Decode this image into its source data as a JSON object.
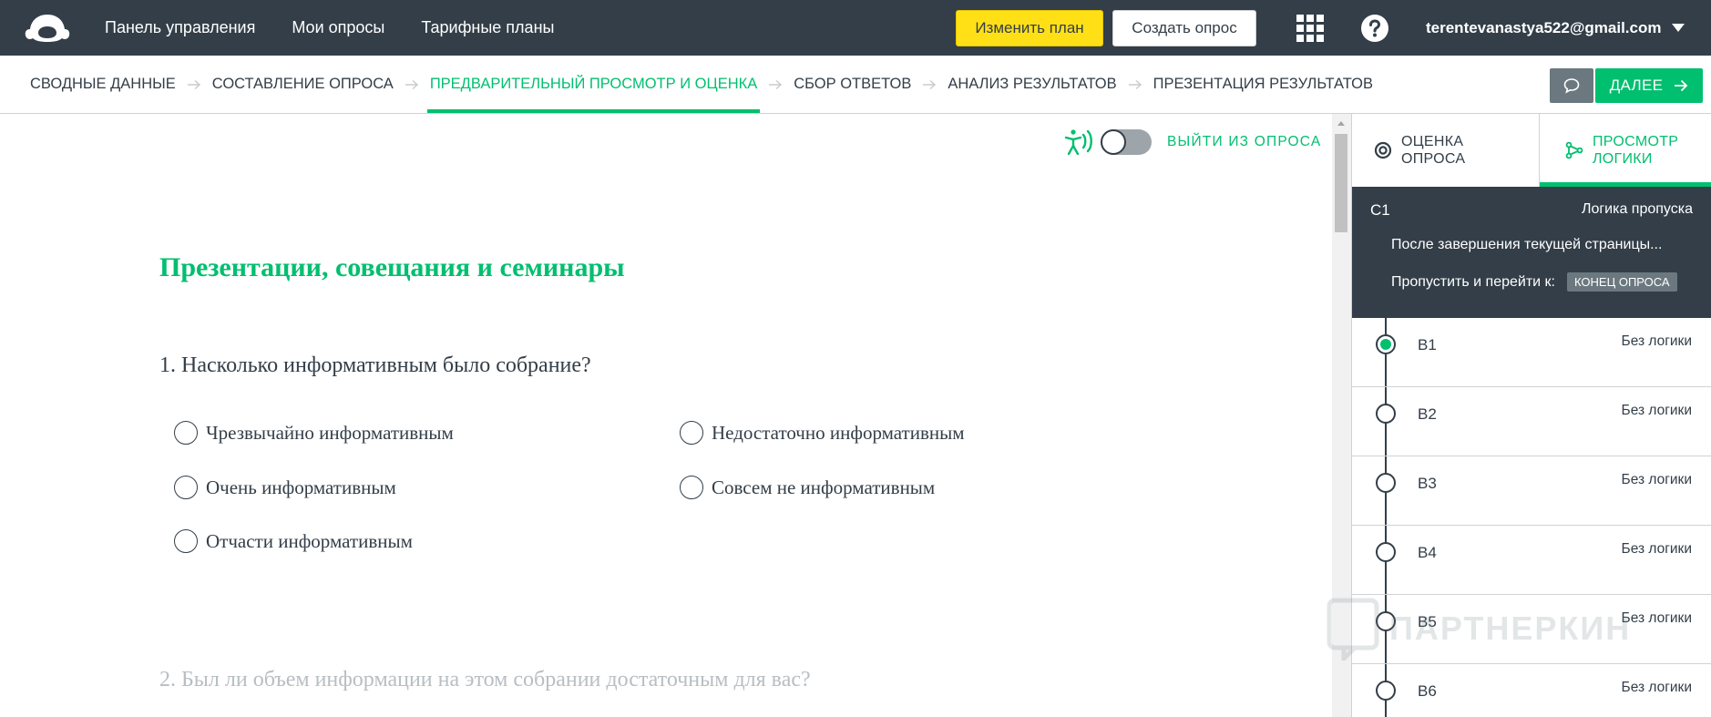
{
  "topbar": {
    "nav": [
      "Панель управления",
      "Мои опросы",
      "Тарифные планы"
    ],
    "upgrade_label": "Изменить план",
    "create_label": "Создать опрос",
    "account_email": "terentevanastya522@gmail.com",
    "colors": {
      "background": "#333e48",
      "upgrade": "#ffe017"
    }
  },
  "steps": {
    "items": [
      {
        "label": "СВОДНЫЕ ДАННЫЕ"
      },
      {
        "label": "СОСТАВЛЕНИЕ ОПРОСА"
      },
      {
        "label": "ПРЕДВАРИТЕЛЬНЫЙ ПРОСМОТР И ОЦЕНКА"
      },
      {
        "label": "СБОР ОТВЕТОВ"
      },
      {
        "label": "АНАЛИЗ РЕЗУЛЬТАТОВ"
      },
      {
        "label": "ПРЕЗЕНТАЦИЯ РЕЗУЛЬТАТОВ"
      }
    ],
    "active_index": 2,
    "next_label": "ДАЛЕЕ",
    "accent": "#00bf6f"
  },
  "preview": {
    "exit_label": "ВЫЙТИ ИЗ ОПРОСА",
    "accessibility_toggle_on": false,
    "page_title": "Презентации, совещания и семинары",
    "q1": {
      "text": "1. Насколько информативным было собрание?",
      "options": [
        "Чрезвычайно информативным",
        "Недостаточно информативным",
        "Очень информативным",
        "Совсем не информативным",
        "Отчасти информативным"
      ]
    },
    "q2": {
      "text": "2. Был ли объем информации на этом собрании достаточным для вас?"
    }
  },
  "panel": {
    "tabs": [
      {
        "label": "ОЦЕНКА\nОПРОСА",
        "icon": "gauge-icon"
      },
      {
        "label": "ПРОСМОТР\nЛОГИКИ",
        "icon": "branch-icon"
      }
    ],
    "active_tab": 1,
    "logic": {
      "page": "С1",
      "logic_type": "Логика пропуска",
      "after_text": "После завершения текущей страницы...",
      "skip_text": "Пропустить и перейти к:",
      "skip_target": "КОНЕЦ ОПРОСА"
    },
    "questions": [
      {
        "label": "В1",
        "logic": "Без логики"
      },
      {
        "label": "В2",
        "logic": "Без логики"
      },
      {
        "label": "В3",
        "logic": "Без логики"
      },
      {
        "label": "В4",
        "logic": "Без логики"
      },
      {
        "label": "В5",
        "logic": "Без логики"
      },
      {
        "label": "В6",
        "logic": "Без логики"
      }
    ],
    "active_question": 0
  },
  "watermark": {
    "text": "ПАРТНЕРКИН"
  }
}
